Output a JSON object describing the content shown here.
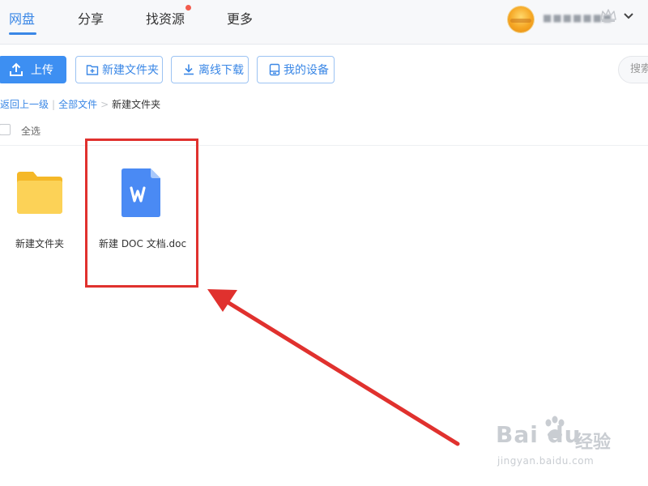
{
  "nav": {
    "tabs": [
      {
        "label": "网盘",
        "active": true
      },
      {
        "label": "分享",
        "active": false
      },
      {
        "label": "找资源",
        "active": false,
        "has_dot": true
      },
      {
        "label": "更多",
        "active": false
      }
    ]
  },
  "user": {
    "name": "■■■■■■■",
    "vip_icon": "crown-icon",
    "menu_icon": "chevron-down-icon"
  },
  "toolbar": {
    "upload": "上传",
    "new_folder": "新建文件夹",
    "offline_download": "离线下载",
    "my_devices": "我的设备"
  },
  "search": {
    "placeholder": "搜索"
  },
  "breadcrumb": {
    "back": "返回上一级",
    "all_files": "全部文件",
    "current": "新建文件夹"
  },
  "list": {
    "select_all": "全选"
  },
  "files": [
    {
      "name": "新建文件夹",
      "icon": "folder-icon"
    },
    {
      "name": "新建 DOC 文档.doc",
      "icon": "word-doc-icon"
    }
  ],
  "watermark": {
    "logo": "Bai du",
    "cn": "经验",
    "url": "jingyan.baidu.com"
  },
  "colors": {
    "accent": "#3a87e6",
    "primary_button": "#3d8ff2",
    "folder": "#fcc93e",
    "word_doc": "#4a8af4",
    "annotation": "#e0312e"
  }
}
